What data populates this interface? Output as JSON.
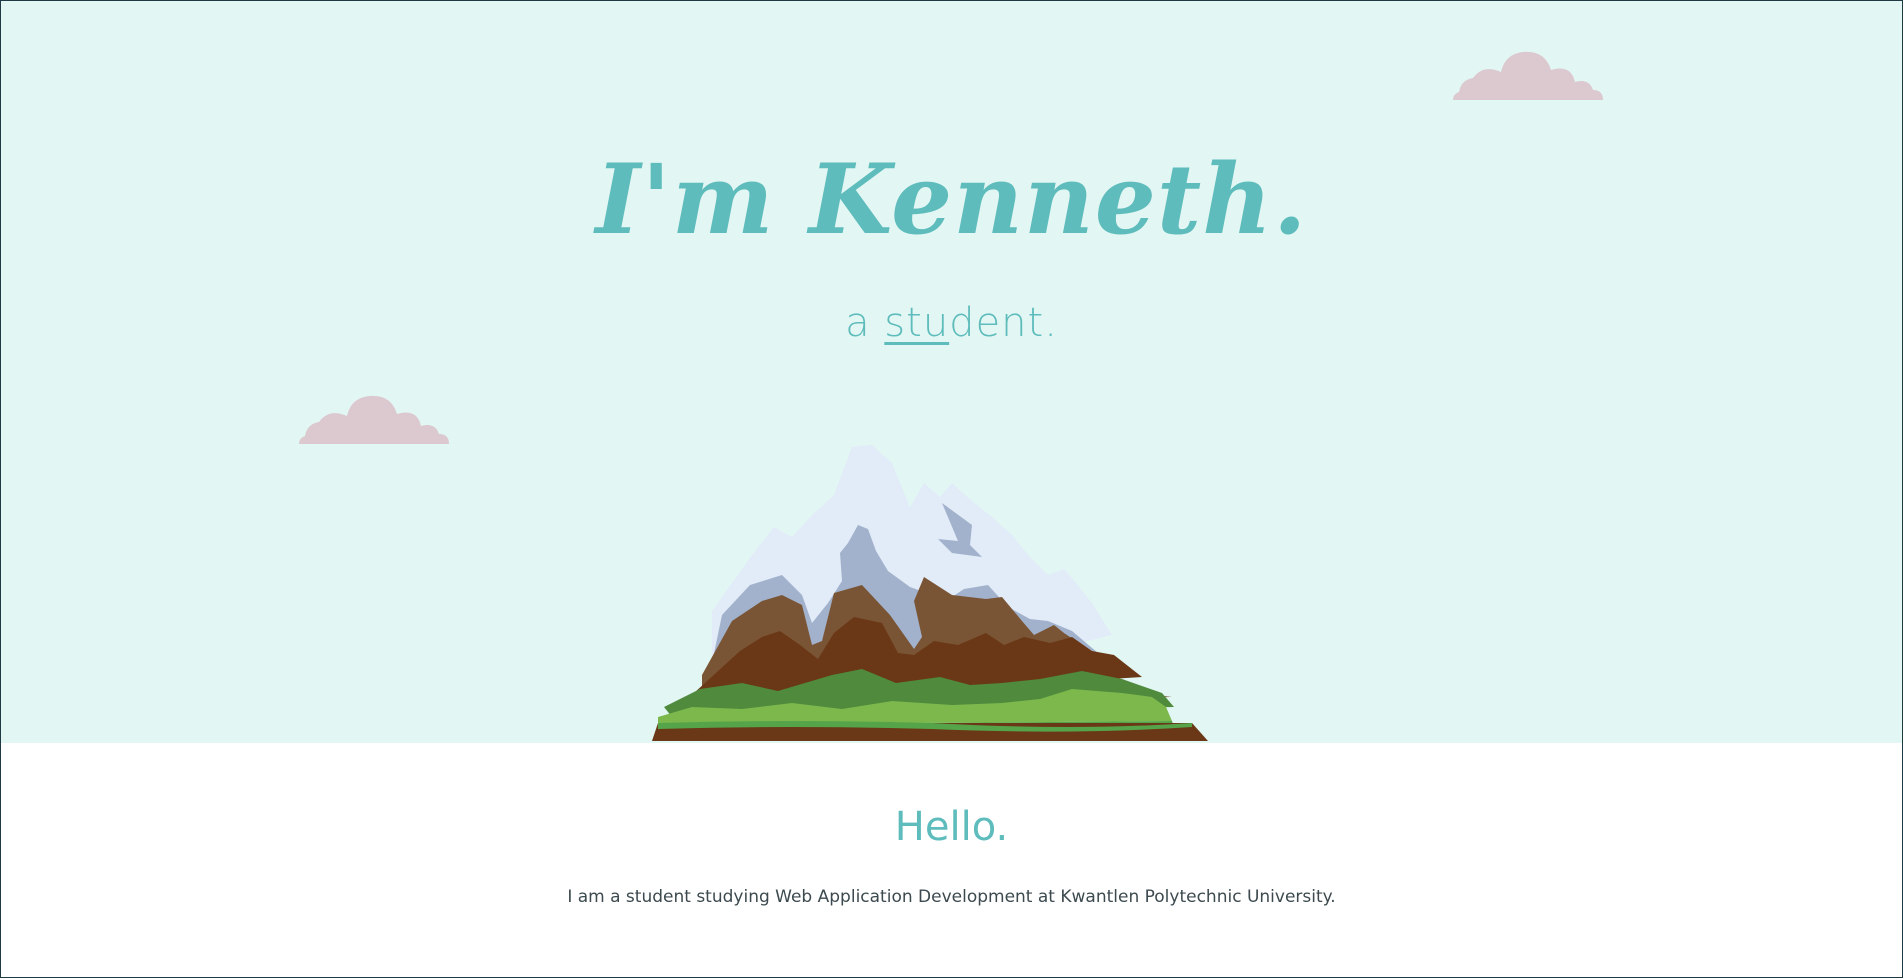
{
  "hero": {
    "title": "I'm Kenneth.",
    "subtitle_prefix": "a ",
    "subtitle_typed": "stu",
    "subtitle_rest": "dent."
  },
  "about": {
    "heading": "Hello.",
    "body": "I am a student studying Web Application Development at Kwantlen Polytechnic University."
  },
  "colors": {
    "sky": "#e2f7f3",
    "accent": "#5fbcbc",
    "cloud": "#dcc8cf",
    "text": "#3c4a4f"
  },
  "icons": [
    "cloud-icon",
    "mountain-illustration"
  ]
}
